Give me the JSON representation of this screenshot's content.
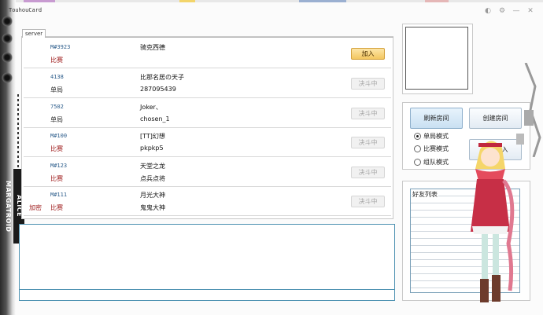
{
  "window": {
    "title": "TouhouCard",
    "controls": [
      "◐",
      "⚙",
      "—",
      "✕"
    ]
  },
  "sidebar_banner": "ALICE MARGATROID",
  "server_tab": "server",
  "rooms": [
    {
      "id": "M#3923",
      "mode": "比赛",
      "mode_type": "match",
      "lock": "",
      "player1": "骑克西德",
      "player2": "",
      "button": "加入",
      "button_type": "join"
    },
    {
      "id": "4138",
      "mode": "单局",
      "mode_type": "single",
      "lock": "",
      "player1": "比那名居の天子",
      "player2": "287095439",
      "button": "决斗中",
      "button_type": "fighting"
    },
    {
      "id": "7502",
      "mode": "单局",
      "mode_type": "single",
      "lock": "",
      "player1": "Joker、",
      "player2": "chosen_1",
      "button": "决斗中",
      "button_type": "fighting"
    },
    {
      "id": "M#100",
      "mode": "比赛",
      "mode_type": "match",
      "lock": "",
      "player1": "[TT]幻想",
      "player2": "pkpkp5",
      "button": "决斗中",
      "button_type": "fighting"
    },
    {
      "id": "M#123",
      "mode": "比赛",
      "mode_type": "match",
      "lock": "",
      "player1": "天堂之龙",
      "player2": "点兵点将",
      "button": "决斗中",
      "button_type": "fighting"
    },
    {
      "id": "M#111",
      "mode": "比赛",
      "mode_type": "match",
      "lock": "加密",
      "player1": "月光大神",
      "player2": "鬼鬼大神",
      "button": "决斗中",
      "button_type": "fighting"
    }
  ],
  "controls": {
    "refresh": "刷新房间",
    "create": "创建房间",
    "quick_join": "快速加入",
    "modes": [
      {
        "label": "单局模式",
        "checked": true
      },
      {
        "label": "比赛模式",
        "checked": false
      },
      {
        "label": "组队模式",
        "checked": false
      }
    ]
  },
  "friends": {
    "title": "好友列表"
  },
  "colors": {
    "match_text": "#a02020",
    "room_id": "#2a5b8a",
    "join_button": "#f3c660",
    "chat_border": "#4a90b0"
  }
}
